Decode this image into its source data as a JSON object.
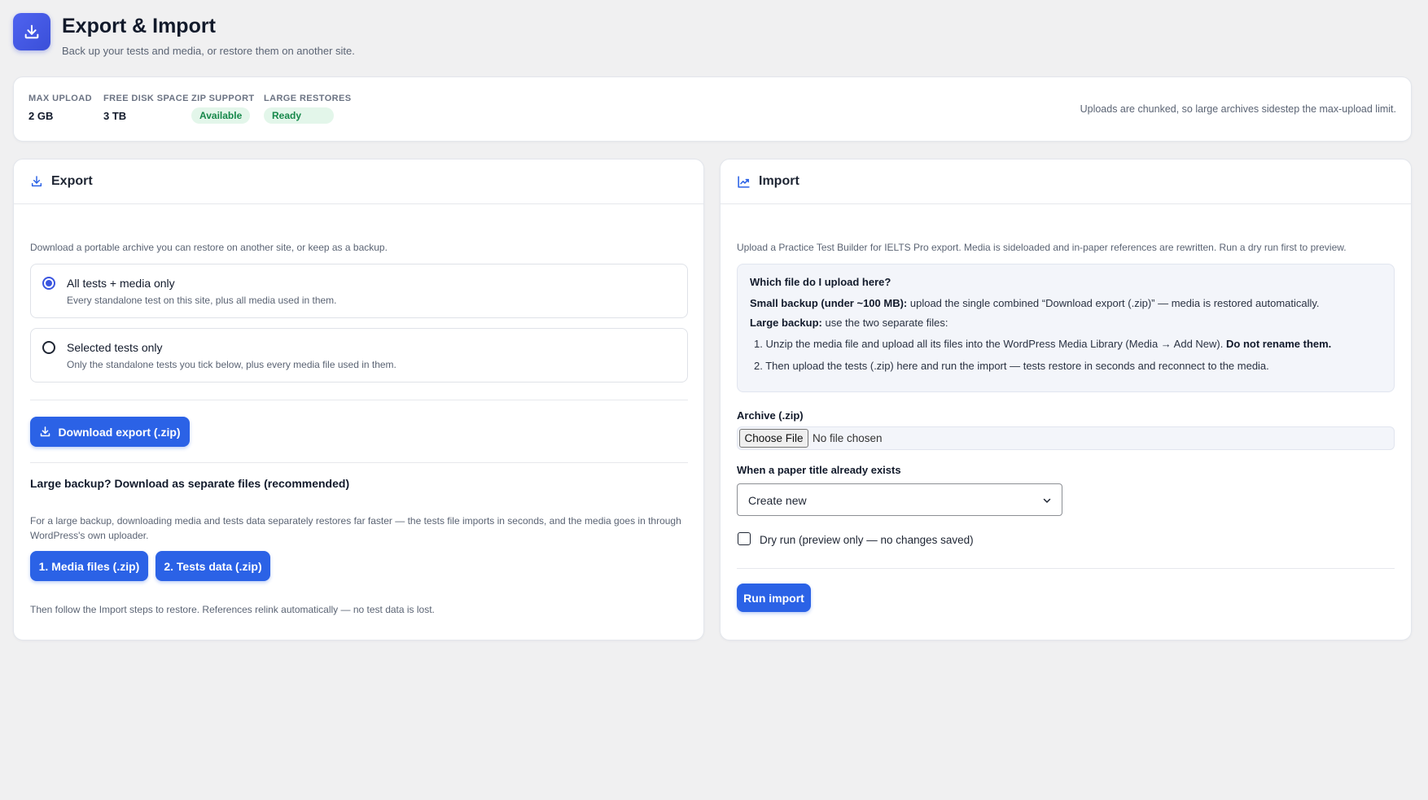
{
  "header": {
    "title": "Export & Import",
    "subtitle": "Back up your tests and media, or restore them on another site.",
    "icon": "download-icon"
  },
  "stats": {
    "max_upload": {
      "label": "MAX UPLOAD",
      "value": "2 GB"
    },
    "free_disk": {
      "label": "FREE DISK SPACE",
      "value": "3 TB"
    },
    "zip_support": {
      "label": "ZIP SUPPORT",
      "badge": "Available"
    },
    "large_restores": {
      "label": "LARGE RESTORES",
      "badge": "Ready"
    },
    "note": "Uploads are chunked, so large archives sidestep the max-upload limit."
  },
  "export": {
    "title": "Export",
    "description": "Download a portable archive you can restore on another site, or keep as a backup.",
    "options": [
      {
        "title": "All tests + media only",
        "subtitle": "Every standalone test on this site, plus all media used in them.",
        "selected": true
      },
      {
        "title": "Selected tests only",
        "subtitle": "Only the standalone tests you tick below, plus every media file used in them.",
        "selected": false
      }
    ],
    "download_button": "Download export (.zip)",
    "large_backup_title": "Large backup? Download as separate files (recommended)",
    "large_backup_desc_1": "For a large backup, downloading media and tests data separately restores far faster — the tests file imports in seconds, and the media goes in through",
    "large_backup_desc_2": "WordPress's own uploader.",
    "media_button": "1. Media files (.zip)",
    "tests_button": "2. Tests data (.zip)",
    "footer_note": "Then follow the Import steps to restore. References relink automatically — no test data is lost."
  },
  "import": {
    "title": "Import",
    "description": "Upload a Practice Test Builder for IELTS Pro export. Media is sideloaded and in-paper references are rewritten. Run a dry run first to preview.",
    "help": {
      "title": "Which file do I upload here?",
      "small_label": "Small backup (under ~100 MB):",
      "small_text": "upload the single combined “Download export (.zip)” — media is restored automatically.",
      "large_label": "Large backup:",
      "large_text": "use the two separate files:",
      "step1_text": "1. Unzip the media file and upload all its files into the WordPress Media Library (Media → Add New).",
      "step1_bold": "Do not rename them.",
      "step2_text": "2. Then upload the tests (.zip) here and run the import — tests restore in seconds and reconnect to the media."
    },
    "archive_label": "Archive (.zip)",
    "choose_file": "Choose File",
    "no_file": "No file chosen",
    "conflict_label": "When a paper title already exists",
    "conflict_value": "Create new",
    "dry_run_label": "Dry run (preview only — no changes saved)",
    "dry_run_checked": false,
    "run_button": "Run import"
  },
  "colors": {
    "accent": "#2b62e6",
    "badge_bg": "#e3f6ea",
    "badge_text": "#16884a",
    "background": "#f0f0f1"
  }
}
